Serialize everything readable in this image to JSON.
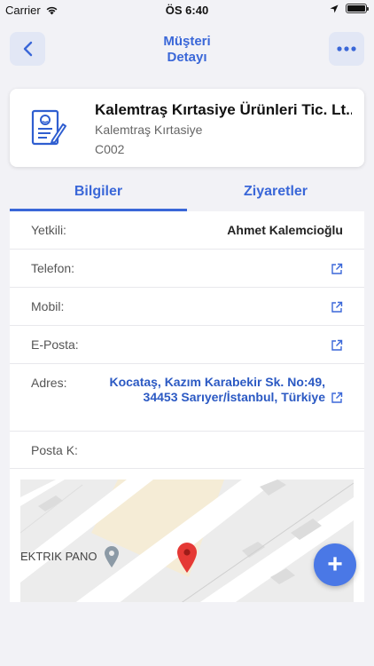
{
  "status_bar": {
    "carrier": "Carrier",
    "time": "ÖS 6:40",
    "icons": [
      "wifi-icon",
      "location-arrow-icon",
      "battery-icon"
    ]
  },
  "nav": {
    "title_line1": "Müşteri",
    "title_line2": "Detayı",
    "back_icon": "chevron-left-icon",
    "more_icon": "ellipsis-icon"
  },
  "customer": {
    "name": "Kalemtraş Kırtasiye Ürünleri Tic. Lt...",
    "short_name": "Kalemtraş Kırtasiye",
    "code": "C002",
    "icon": "contract-document-icon"
  },
  "tabs": [
    {
      "label": "Bilgiler",
      "active": true
    },
    {
      "label": "Ziyaretler",
      "active": false
    }
  ],
  "details": {
    "contact_label": "Yetkili:",
    "contact_value": "Ahmet Kalemcioğlu",
    "phone_label": "Telefon:",
    "mobile_label": "Mobil:",
    "email_label": "E-Posta:",
    "address_label": "Adres:",
    "address_value": "Kocataş, Kazım Karabekir Sk. No:49, 34453 Sarıyer/İstanbul, Türkiye",
    "postal_label": "Posta K:"
  },
  "map": {
    "poi_label": "EKTRIK PANO"
  },
  "fab": {
    "label": "+"
  },
  "colors": {
    "accent": "#3a67d8",
    "link": "#2b59c3",
    "fab": "#4a78e6",
    "map_pin": "#e53935"
  }
}
